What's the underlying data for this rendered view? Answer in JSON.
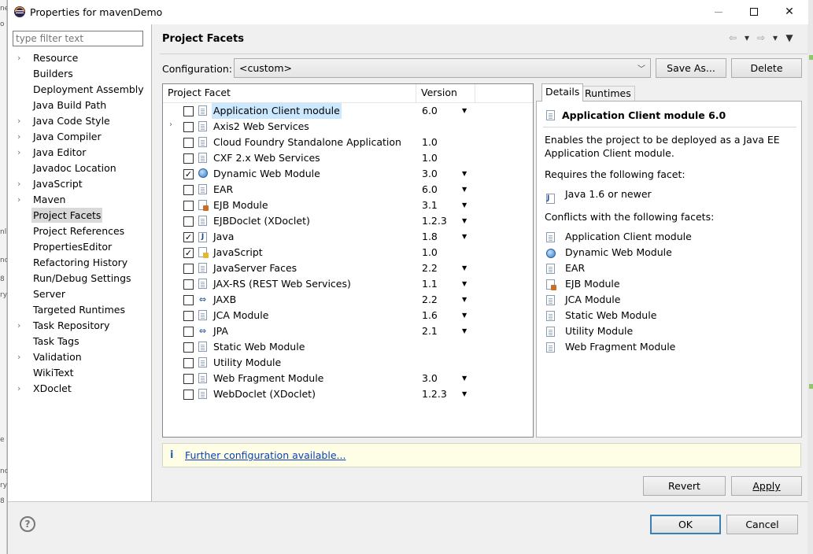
{
  "window": {
    "title": "Properties for mavenDemo",
    "minimize_label": "",
    "maximize_label": "",
    "close_label": "✕"
  },
  "background_fragments": [
    "ne",
    "o",
    "",
    "",
    "nl",
    "nc",
    "8",
    "ry",
    "e",
    "nc",
    "ry",
    "8"
  ],
  "nav": {
    "filter_placeholder": "type filter text",
    "items": [
      {
        "label": "Resource",
        "expandable": true
      },
      {
        "label": "Builders",
        "expandable": false
      },
      {
        "label": "Deployment Assembly",
        "expandable": false
      },
      {
        "label": "Java Build Path",
        "expandable": false
      },
      {
        "label": "Java Code Style",
        "expandable": true
      },
      {
        "label": "Java Compiler",
        "expandable": true
      },
      {
        "label": "Java Editor",
        "expandable": true
      },
      {
        "label": "Javadoc Location",
        "expandable": false
      },
      {
        "label": "JavaScript",
        "expandable": true
      },
      {
        "label": "Maven",
        "expandable": true
      },
      {
        "label": "Project Facets",
        "expandable": false,
        "selected": true
      },
      {
        "label": "Project References",
        "expandable": false
      },
      {
        "label": "PropertiesEditor",
        "expandable": false
      },
      {
        "label": "Refactoring History",
        "expandable": false
      },
      {
        "label": "Run/Debug Settings",
        "expandable": false
      },
      {
        "label": "Server",
        "expandable": false
      },
      {
        "label": "Targeted Runtimes",
        "expandable": false
      },
      {
        "label": "Task Repository",
        "expandable": true
      },
      {
        "label": "Task Tags",
        "expandable": false
      },
      {
        "label": "Validation",
        "expandable": true
      },
      {
        "label": "WikiText",
        "expandable": false
      },
      {
        "label": "XDoclet",
        "expandable": true
      }
    ]
  },
  "header": {
    "title": "Project Facets",
    "back_icon": "back-arrow-icon",
    "forward_icon": "forward-arrow-icon"
  },
  "configuration": {
    "label": "Configuration:",
    "value": "<custom>",
    "save_as_label": "Save As...",
    "delete_label": "Delete"
  },
  "facets": {
    "col_facet": "Project Facet",
    "col_version": "Version",
    "rows": [
      {
        "name": "Application Client module",
        "version": "6.0",
        "checked": false,
        "icon": "doc",
        "dropdown": true,
        "selected": true,
        "expandable": false
      },
      {
        "name": "Axis2 Web Services",
        "version": "",
        "checked": false,
        "icon": "doc",
        "dropdown": false,
        "expandable": true
      },
      {
        "name": "Cloud Foundry Standalone Application",
        "version": "1.0",
        "checked": false,
        "icon": "doc",
        "dropdown": false,
        "expandable": false
      },
      {
        "name": "CXF 2.x Web Services",
        "version": "1.0",
        "checked": false,
        "icon": "doc",
        "dropdown": false,
        "expandable": false
      },
      {
        "name": "Dynamic Web Module",
        "version": "3.0",
        "checked": true,
        "icon": "globe",
        "dropdown": true,
        "expandable": false
      },
      {
        "name": "EAR",
        "version": "6.0",
        "checked": false,
        "icon": "doc",
        "dropdown": true,
        "expandable": false
      },
      {
        "name": "EJB Module",
        "version": "3.1",
        "checked": false,
        "icon": "ejb",
        "dropdown": true,
        "expandable": false
      },
      {
        "name": "EJBDoclet (XDoclet)",
        "version": "1.2.3",
        "checked": false,
        "icon": "doc",
        "dropdown": true,
        "expandable": false
      },
      {
        "name": "Java",
        "version": "1.8",
        "checked": true,
        "icon": "java",
        "dropdown": true,
        "expandable": false
      },
      {
        "name": "JavaScript",
        "version": "1.0",
        "checked": true,
        "icon": "js",
        "dropdown": false,
        "expandable": false
      },
      {
        "name": "JavaServer Faces",
        "version": "2.2",
        "checked": false,
        "icon": "doc",
        "dropdown": true,
        "expandable": false
      },
      {
        "name": "JAX-RS (REST Web Services)",
        "version": "1.1",
        "checked": false,
        "icon": "doc",
        "dropdown": true,
        "expandable": false
      },
      {
        "name": "JAXB",
        "version": "2.2",
        "checked": false,
        "icon": "jaxb",
        "dropdown": true,
        "expandable": false
      },
      {
        "name": "JCA Module",
        "version": "1.6",
        "checked": false,
        "icon": "doc",
        "dropdown": true,
        "expandable": false
      },
      {
        "name": "JPA",
        "version": "2.1",
        "checked": false,
        "icon": "jaxb",
        "dropdown": true,
        "expandable": false
      },
      {
        "name": "Static Web Module",
        "version": "",
        "checked": false,
        "icon": "doc",
        "dropdown": false,
        "expandable": false
      },
      {
        "name": "Utility Module",
        "version": "",
        "checked": false,
        "icon": "doc",
        "dropdown": false,
        "expandable": false
      },
      {
        "name": "Web Fragment Module",
        "version": "3.0",
        "checked": false,
        "icon": "doc",
        "dropdown": true,
        "expandable": false
      },
      {
        "name": "WebDoclet (XDoclet)",
        "version": "1.2.3",
        "checked": false,
        "icon": "doc",
        "dropdown": true,
        "expandable": false
      }
    ]
  },
  "details": {
    "tab_details": "Details",
    "tab_runtimes": "Runtimes",
    "title": "Application Client module 6.0",
    "description": "Enables the project to be deployed as a Java EE Application Client module.",
    "requires_label": "Requires the following facet:",
    "requires": [
      {
        "label": "Java 1.6 or newer",
        "icon": "java"
      }
    ],
    "conflicts_label": "Conflicts with the following facets:",
    "conflicts": [
      {
        "label": "Application Client module",
        "icon": "doc"
      },
      {
        "label": "Dynamic Web Module",
        "icon": "globe"
      },
      {
        "label": "EAR",
        "icon": "doc"
      },
      {
        "label": "EJB Module",
        "icon": "ejb"
      },
      {
        "label": "JCA Module",
        "icon": "doc"
      },
      {
        "label": "Static Web Module",
        "icon": "doc"
      },
      {
        "label": "Utility Module",
        "icon": "doc"
      },
      {
        "label": "Web Fragment Module",
        "icon": "doc"
      }
    ]
  },
  "info": {
    "icon": "i",
    "link_text": "Further configuration available..."
  },
  "actions": {
    "revert_label": "Revert",
    "apply_label": "Apply",
    "ok_label": "OK",
    "cancel_label": "Cancel",
    "help_label": "?"
  }
}
